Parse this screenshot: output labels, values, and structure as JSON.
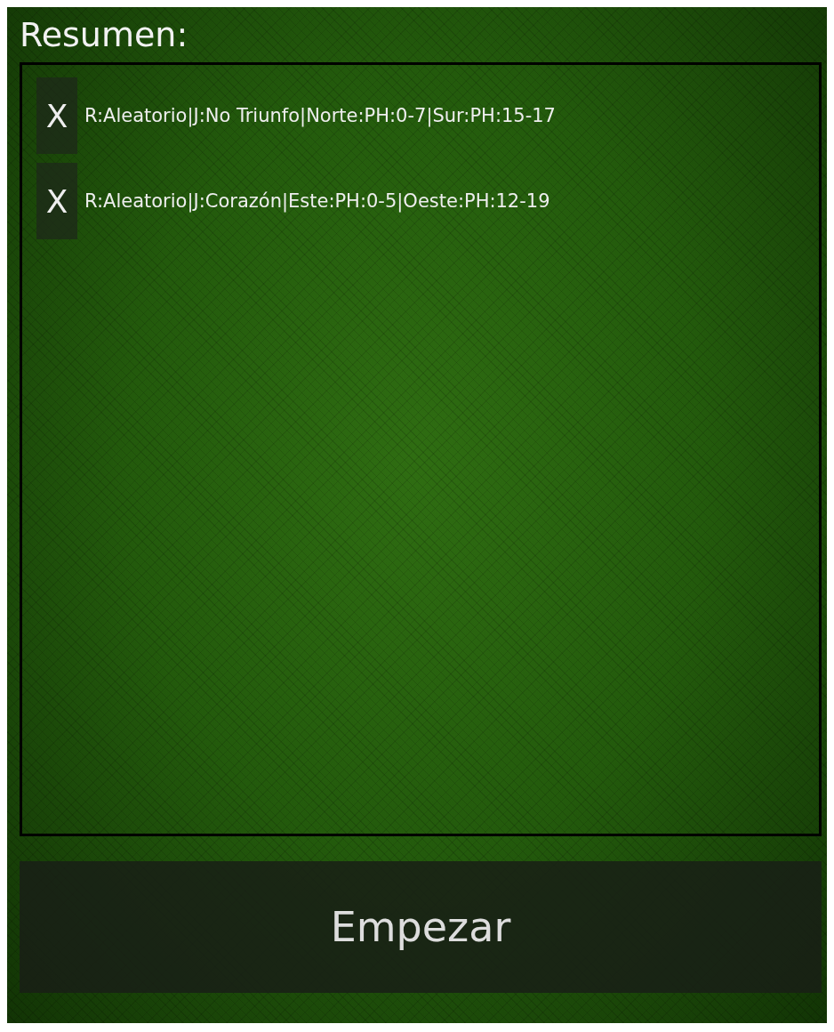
{
  "title": "Resumen:",
  "entries": [
    {
      "remove": "X",
      "text": "R:Aleatorio|J:No Triunfo|Norte:PH:0-7|Sur:PH:15-17"
    },
    {
      "remove": "X",
      "text": "R:Aleatorio|J:Corazón|Este:PH:0-5|Oeste:PH:12-19"
    }
  ],
  "start_button": "Empezar"
}
